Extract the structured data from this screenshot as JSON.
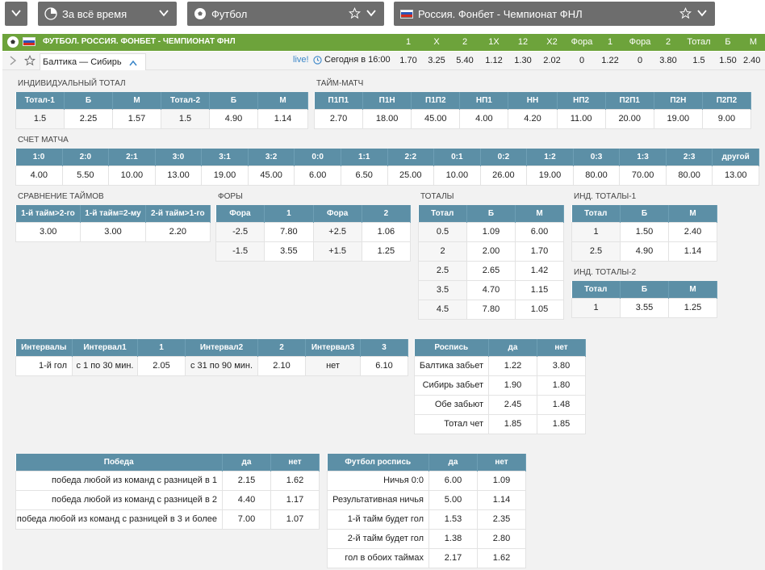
{
  "filters": {
    "period": "За всё время",
    "sport": "Футбол",
    "league": "Россия. Фонбет - Чемпионат ФНЛ"
  },
  "league_row": {
    "title": "ФУТБОЛ. РОССИЯ. ФОНБЕТ - ЧЕМПИОНАТ ФНЛ",
    "columns": [
      "1",
      "X",
      "2",
      "1X",
      "12",
      "X2",
      "Фора",
      "1",
      "Фора",
      "2",
      "Тотал",
      "Б",
      "М"
    ]
  },
  "event": {
    "name": "Балтика — Сибирь",
    "live": "live!",
    "time": "Сегодня в 16:00",
    "odds": [
      "1.70",
      "3.25",
      "5.40",
      "1.12",
      "1.30",
      "2.02",
      "0",
      "1.22",
      "0",
      "3.80",
      "1.5",
      "1.50",
      "2.40"
    ]
  },
  "ind_total": {
    "title": "ИНДИВИДУАЛЬНЫЙ ТОТАЛ",
    "headers": [
      "Тотал-1",
      "Б",
      "М",
      "Тотал-2",
      "Б",
      "М"
    ],
    "row": [
      "1.5",
      "2.25",
      "1.57",
      "1.5",
      "4.90",
      "1.14"
    ]
  },
  "time_match": {
    "title": "ТАЙМ-МАТЧ",
    "headers": [
      "П1П1",
      "П1Н",
      "П1П2",
      "НП1",
      "НН",
      "НП2",
      "П2П1",
      "П2Н",
      "П2П2"
    ],
    "row": [
      "2.70",
      "18.00",
      "45.00",
      "4.00",
      "4.20",
      "11.00",
      "20.00",
      "19.00",
      "9.00"
    ]
  },
  "score": {
    "title": "СЧЕТ МАТЧА",
    "headers": [
      "1:0",
      "2:0",
      "2:1",
      "3:0",
      "3:1",
      "3:2",
      "0:0",
      "1:1",
      "2:2",
      "0:1",
      "0:2",
      "1:2",
      "0:3",
      "1:3",
      "2:3",
      "другой"
    ],
    "row": [
      "4.00",
      "5.50",
      "10.00",
      "13.00",
      "19.00",
      "45.00",
      "6.00",
      "6.50",
      "25.00",
      "10.00",
      "26.00",
      "19.00",
      "80.00",
      "70.00",
      "80.00",
      "13.00"
    ]
  },
  "halves": {
    "title": "СРАВНЕНИЕ ТАЙМОВ",
    "headers": [
      "1-й тайм>2-го",
      "1-й тайм=2-му",
      "2-й тайм>1-го"
    ],
    "row": [
      "3.00",
      "3.00",
      "2.20"
    ]
  },
  "handicap": {
    "title": "ФОРЫ",
    "headers": [
      "Фора",
      "1",
      "Фора",
      "2"
    ],
    "rows": [
      [
        "-2.5",
        "7.80",
        "+2.5",
        "1.06"
      ],
      [
        "-1.5",
        "3.55",
        "+1.5",
        "1.25"
      ]
    ]
  },
  "totals": {
    "title": "ТОТАЛЫ",
    "headers": [
      "Тотал",
      "Б",
      "М"
    ],
    "rows": [
      [
        "0.5",
        "1.09",
        "6.00"
      ],
      [
        "2",
        "2.00",
        "1.70"
      ],
      [
        "2.5",
        "2.65",
        "1.42"
      ],
      [
        "3.5",
        "4.70",
        "1.15"
      ],
      [
        "4.5",
        "7.80",
        "1.05"
      ]
    ]
  },
  "ind_totals_1": {
    "title": "ИНД. ТОТАЛЫ-1",
    "headers": [
      "Тотал",
      "Б",
      "М"
    ],
    "rows": [
      [
        "1",
        "1.50",
        "2.40"
      ],
      [
        "2.5",
        "4.90",
        "1.14"
      ]
    ]
  },
  "ind_totals_2": {
    "title": "ИНД. ТОТАЛЫ-2",
    "headers": [
      "Тотал",
      "Б",
      "М"
    ],
    "rows": [
      [
        "1",
        "3.55",
        "1.25"
      ]
    ]
  },
  "intervals": {
    "headers": [
      "Интервалы",
      "Интервал1",
      "1",
      "Интервал2",
      "2",
      "Интервал3",
      "3"
    ],
    "row": [
      "1-й гол",
      "с 1 по 30 мин.",
      "2.05",
      "с 31 по 90 мин.",
      "2.10",
      "нет",
      "6.10"
    ]
  },
  "scorecard": {
    "headers": [
      "Роспись",
      "да",
      "нет"
    ],
    "rows": [
      [
        "Балтика забьет",
        "1.22",
        "3.80"
      ],
      [
        "Сибирь забьет",
        "1.90",
        "1.80"
      ],
      [
        "Обе забьют",
        "2.45",
        "1.48"
      ],
      [
        "Тотал чет",
        "1.85",
        "1.85"
      ]
    ]
  },
  "win": {
    "headers": [
      "Победа",
      "да",
      "нет"
    ],
    "rows": [
      [
        "победа любой из команд с разницей в 1",
        "2.15",
        "1.62"
      ],
      [
        "победа любой из команд с разницей в 2",
        "4.40",
        "1.17"
      ],
      [
        "победа любой из команд с разницей в 3 и более",
        "7.00",
        "1.07"
      ]
    ]
  },
  "football_card": {
    "headers": [
      "Футбол роспись",
      "да",
      "нет"
    ],
    "rows": [
      [
        "Ничья 0:0",
        "6.00",
        "1.09"
      ],
      [
        "Результативная ничья",
        "5.00",
        "1.14"
      ],
      [
        "1-й тайм будет гол",
        "1.53",
        "2.35"
      ],
      [
        "2-й тайм будет гол",
        "1.38",
        "2.80"
      ],
      [
        "гол в обоих таймах",
        "2.17",
        "1.62"
      ]
    ]
  },
  "colors": {
    "header_bar": "#6d6d6d",
    "league_green": "#6da33b",
    "table_header": "#5c8fa6",
    "live_blue": "#3a86c8"
  },
  "icons": [
    "chevron-down-icon",
    "pie-clock-icon",
    "soccer-ball-icon",
    "star-icon",
    "russia-flag-icon",
    "chevron-right-icon",
    "chevron-up-icon",
    "clock-icon"
  ]
}
